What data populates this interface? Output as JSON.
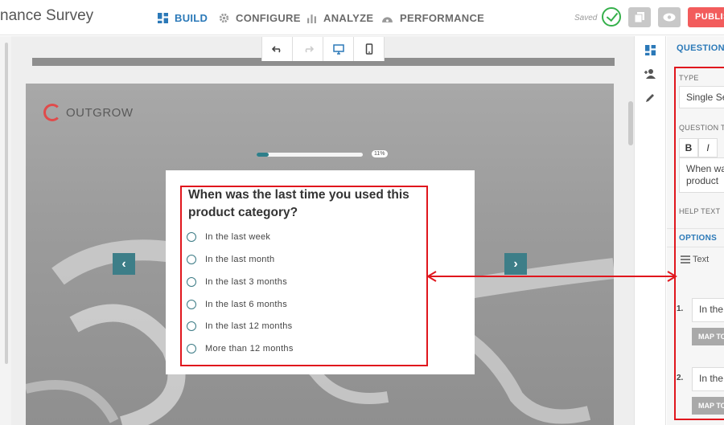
{
  "app_title": "nance Survey",
  "nav": [
    {
      "label": "BUILD",
      "icon": "grid-icon"
    },
    {
      "label": "CONFIGURE",
      "icon": "gear-icon"
    },
    {
      "label": "ANALYZE",
      "icon": "bar-chart-icon"
    },
    {
      "label": "PERFORMANCE",
      "icon": "dashboard-icon"
    }
  ],
  "status": {
    "saved": "Saved"
  },
  "publish_label": "PUBLIS",
  "preview": {
    "logo_text": "OUTGROW",
    "progress_value": 0.11,
    "progress_label": "11%",
    "question": "When was the last time you used this product category?",
    "options": [
      "In the last week",
      "In the last month",
      "In the last 3 months",
      "In the last 6 months",
      "In the last 12 months",
      "More than 12 months"
    ]
  },
  "panel": {
    "title": "QUESTION",
    "type_label": "TYPE",
    "type_value": "Single Se",
    "question_label": "QUESTION T",
    "question_value_line1": "When wa",
    "question_value_line2": "product",
    "help_label": "HELP TEXT",
    "options_label": "OPTIONS",
    "text_select": "Text",
    "option_rows": [
      {
        "num": "1.",
        "value": "In the",
        "map": "MAP TO"
      },
      {
        "num": "2.",
        "value": "In the",
        "map": "MAP TO"
      }
    ],
    "bold": "B",
    "italic": "I"
  },
  "colors": {
    "accent": "#2b79b8",
    "publish": "#f25c5c",
    "highlight": "#e0161d",
    "teal": "#3d7e88"
  }
}
